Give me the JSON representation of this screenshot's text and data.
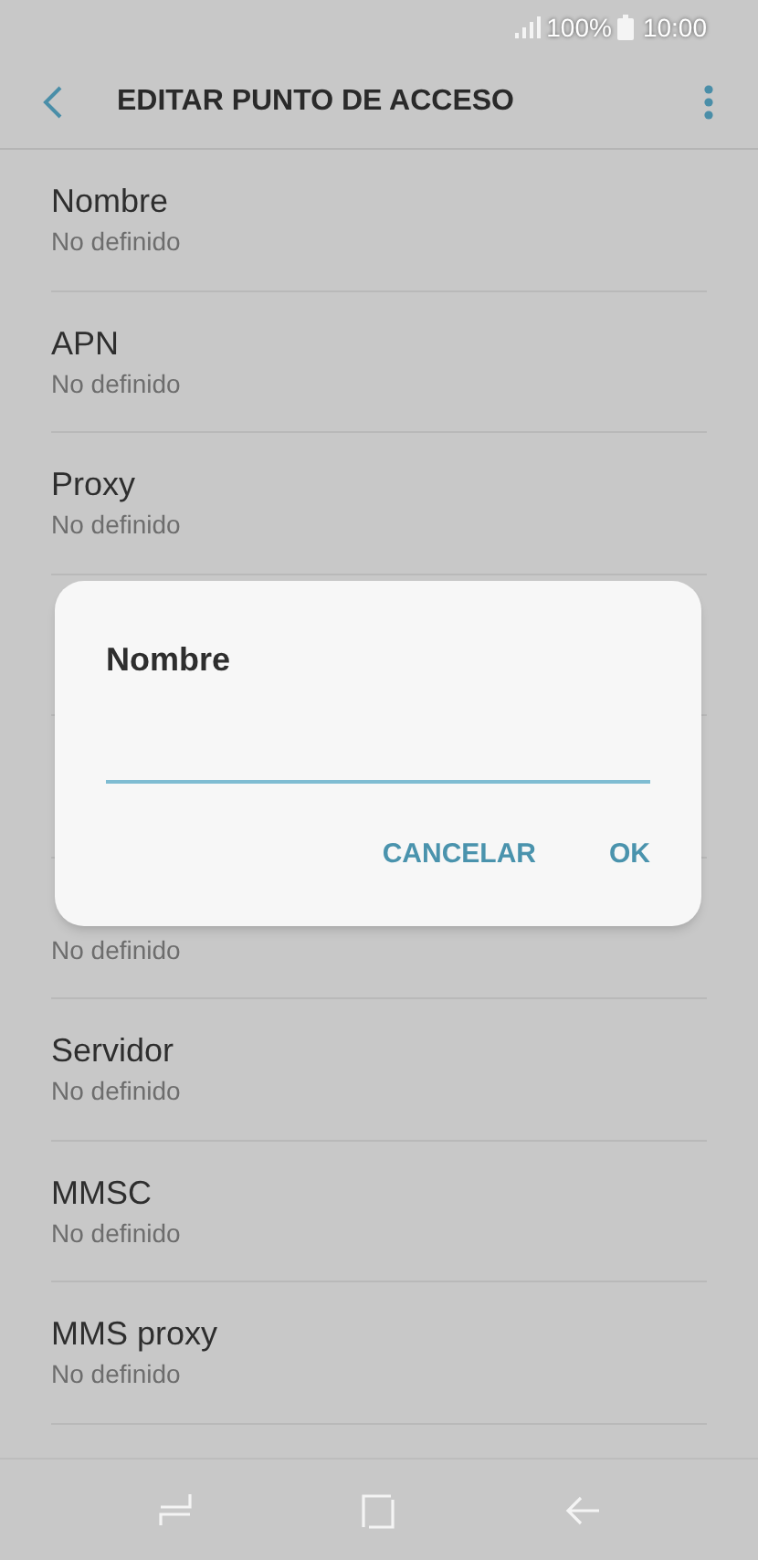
{
  "status_bar": {
    "battery": "100%",
    "time": "10:00"
  },
  "header": {
    "title": "EDITAR PUNTO DE ACCESO"
  },
  "rows": [
    {
      "title": "Nombre",
      "subtitle": "No definido"
    },
    {
      "title": "APN",
      "subtitle": "No definido"
    },
    {
      "title": "Proxy",
      "subtitle": "No definido"
    },
    {},
    {},
    {
      "subtitle": "No definido"
    },
    {
      "title": "Servidor",
      "subtitle": "No definido"
    },
    {
      "title": "MMSC",
      "subtitle": "No definido"
    },
    {
      "title": "MMS proxy",
      "subtitle": "No definido"
    }
  ],
  "dialog": {
    "title": "Nombre",
    "buttons": [
      "CANCELAR",
      "OK"
    ]
  }
}
